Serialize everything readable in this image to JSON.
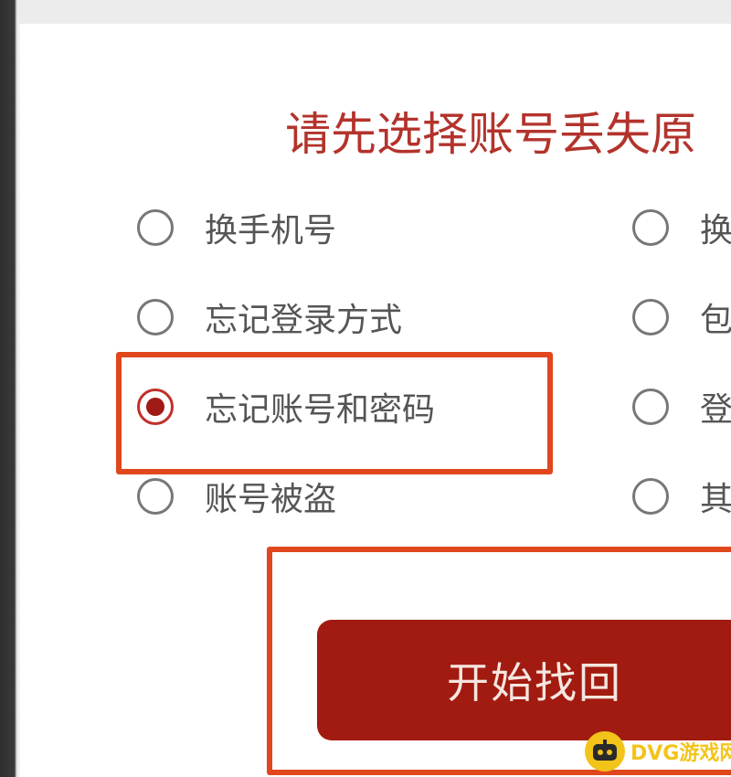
{
  "title": "请先选择账号丢失原",
  "options": [
    {
      "label": "换手机号",
      "checked": false
    },
    {
      "label": "忘记登录方式",
      "checked": false
    },
    {
      "label": "忘记账号和密码",
      "checked": true
    },
    {
      "label": "账号被盗",
      "checked": false
    },
    {
      "label": "换",
      "checked": false
    },
    {
      "label": "包",
      "checked": false
    },
    {
      "label": "登",
      "checked": false
    },
    {
      "label": "其",
      "checked": false
    }
  ],
  "start_button": {
    "label": "开始找回"
  },
  "watermark": {
    "text": "DVG游戏网",
    "icon": "robot-face-icon"
  },
  "colors": {
    "heading": "#b3332c",
    "button": "#a21b10",
    "highlight": "#e0471d",
    "radio_selected": "#a01a16",
    "watermark": "#f2c41a"
  }
}
